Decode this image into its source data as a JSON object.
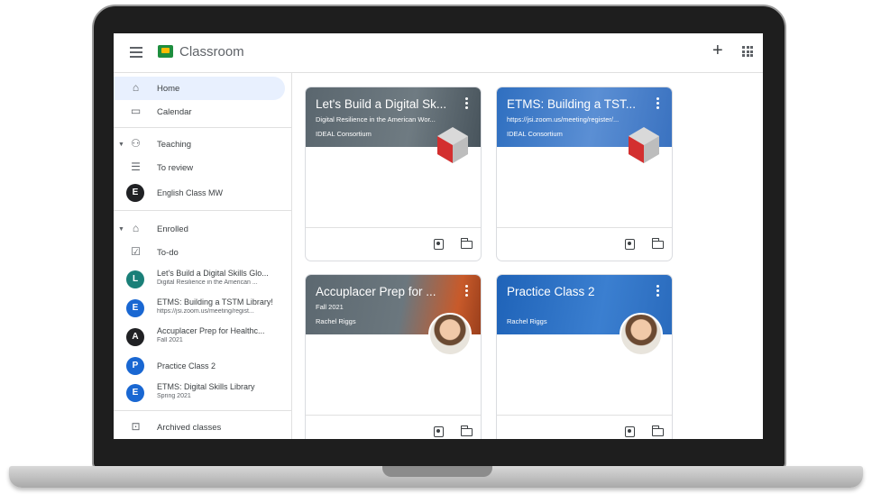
{
  "app": {
    "title": "Classroom"
  },
  "colors": {
    "accent": "#1e8e3e",
    "active_bg": "#e8f0fe",
    "banner_gray": "#5f6b73",
    "banner_blue": "#2f6fc0"
  },
  "icons": {
    "menu": "menu-icon",
    "add": "plus-icon",
    "apps": "apps-icon"
  },
  "sidebar": {
    "nav": [
      {
        "label": "Home",
        "icon": "home-icon"
      },
      {
        "label": "Calendar",
        "icon": "calendar-icon"
      }
    ],
    "teaching": {
      "label": "Teaching",
      "items": [
        {
          "label": "To review",
          "icon": "review-icon"
        },
        {
          "label": "English Class MW",
          "avatar": "E",
          "avatar_color": "#202124"
        }
      ]
    },
    "enrolled": {
      "label": "Enrolled",
      "todo": "To-do",
      "classes": [
        {
          "avatar": "L",
          "avatar_color": "#1a7f78",
          "title": "Let's Build a Digital Skills Glo...",
          "subtitle": "Digital Resilience in the American ..."
        },
        {
          "avatar": "E",
          "avatar_color": "#1967d2",
          "title": "ETMS: Building a TSTM Library!",
          "subtitle": "https://jsi.zoom.us/meeting/regist..."
        },
        {
          "avatar": "A",
          "avatar_color": "#202124",
          "title": "Accuplacer Prep for Healthc...",
          "subtitle": "Fall 2021"
        },
        {
          "avatar": "P",
          "avatar_color": "#1967d2",
          "title": "Practice Class 2",
          "subtitle": ""
        },
        {
          "avatar": "E",
          "avatar_color": "#1967d2",
          "title": "ETMS: Digital Skills Library",
          "subtitle": "Spring 2021"
        }
      ]
    },
    "archived": "Archived classes"
  },
  "cards": [
    {
      "title": "Let's Build a Digital Sk...",
      "subtitle": "Digital Resilience in the American Wor...",
      "owner": "IDEAL Consortium",
      "banner": "#5f6b73"
    },
    {
      "title": "ETMS: Building a TST...",
      "subtitle": "https://jsi.zoom.us/meeting/register/...",
      "owner": "IDEAL Consortium",
      "banner": "#3275c6"
    },
    {
      "title": "Accuplacer Prep for ...",
      "subtitle": "Fall 2021",
      "owner": "Rachel Riggs",
      "banner": "#5f6b73"
    },
    {
      "title": "Practice Class 2",
      "subtitle": "",
      "owner": "Rachel Riggs",
      "banner": "#2f6fc0"
    }
  ]
}
